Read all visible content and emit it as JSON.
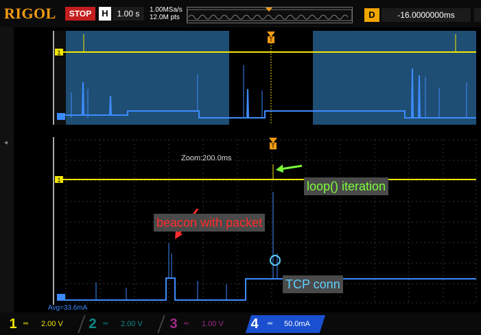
{
  "header": {
    "brand": "RIGOL",
    "run_state": "STOP",
    "timebase_label": "H",
    "timebase_value": "1.00 s",
    "sample_rate": "1.00MSa/s",
    "memory_depth": "12.0M pts",
    "delay_label": "D",
    "delay_value": "-16.0000000ms"
  },
  "zoom": {
    "label": "Zoom:200.0ms"
  },
  "measurement": {
    "avg": "Avg=33.6mA"
  },
  "annotations": {
    "loop": "loop() iteration",
    "beacon": "beacon with packet",
    "tcp": "TCP conn"
  },
  "channels": [
    {
      "num": "1",
      "value": "2.00 V",
      "color": "#f2e600"
    },
    {
      "num": "2",
      "value": "2.00 V",
      "color": "#0e8a8a"
    },
    {
      "num": "3",
      "value": "1.00 V",
      "color": "#a02a8a"
    },
    {
      "num": "4",
      "value": "50.0mA",
      "color": "#3d8cff"
    }
  ],
  "markers": {
    "ch1": "1"
  },
  "colors": {
    "ch1": "#f2e600",
    "ch4": "#3d8cff",
    "trigger": "#f39c12",
    "zoom_region": "#1f4e74"
  }
}
